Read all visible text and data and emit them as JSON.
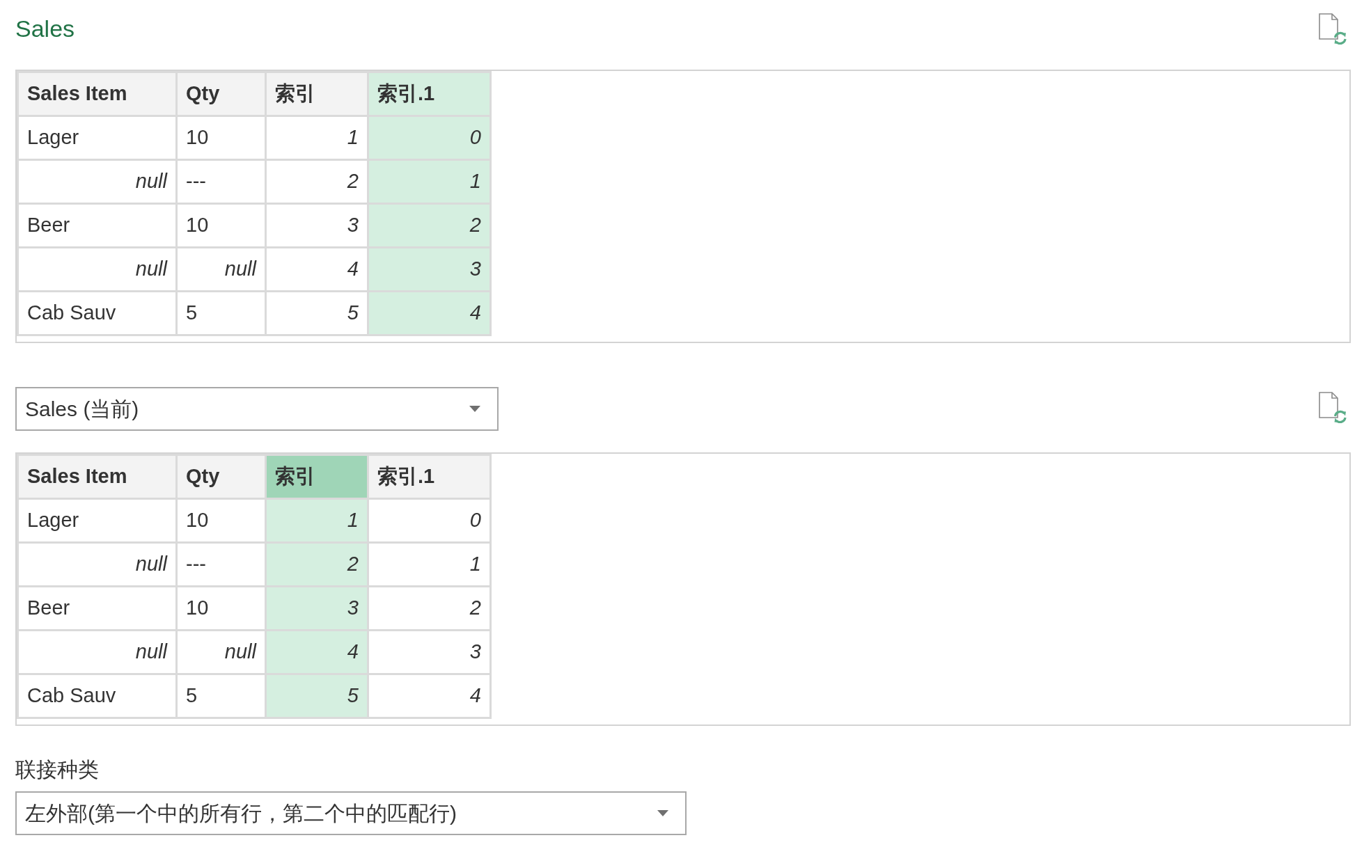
{
  "query_title": "Sales",
  "first_table": {
    "columns": [
      {
        "label": "Sales Item",
        "selected": false,
        "focused": false
      },
      {
        "label": "Qty",
        "selected": false,
        "focused": false
      },
      {
        "label": "索引",
        "selected": false,
        "focused": false
      },
      {
        "label": "索引.1",
        "selected": true,
        "focused": false
      }
    ],
    "rows": [
      {
        "cells": [
          {
            "value": "Lager",
            "kind": "text"
          },
          {
            "value": "10",
            "kind": "text"
          },
          {
            "value": "1",
            "kind": "number"
          },
          {
            "value": "0",
            "kind": "number"
          }
        ]
      },
      {
        "cells": [
          {
            "value": "null",
            "kind": "null"
          },
          {
            "value": "---",
            "kind": "text"
          },
          {
            "value": "2",
            "kind": "number"
          },
          {
            "value": "1",
            "kind": "number"
          }
        ]
      },
      {
        "cells": [
          {
            "value": "Beer",
            "kind": "text"
          },
          {
            "value": "10",
            "kind": "text"
          },
          {
            "value": "3",
            "kind": "number"
          },
          {
            "value": "2",
            "kind": "number"
          }
        ]
      },
      {
        "cells": [
          {
            "value": "null",
            "kind": "null"
          },
          {
            "value": "null",
            "kind": "null"
          },
          {
            "value": "4",
            "kind": "number"
          },
          {
            "value": "3",
            "kind": "number"
          }
        ]
      },
      {
        "cells": [
          {
            "value": "Cab Sauv",
            "kind": "text"
          },
          {
            "value": "5",
            "kind": "text"
          },
          {
            "value": "5",
            "kind": "number"
          },
          {
            "value": "4",
            "kind": "number"
          }
        ]
      }
    ]
  },
  "second_query_dropdown": {
    "value": "Sales (当前)"
  },
  "second_table": {
    "columns": [
      {
        "label": "Sales Item",
        "selected": false,
        "focused": false
      },
      {
        "label": "Qty",
        "selected": false,
        "focused": false
      },
      {
        "label": "索引",
        "selected": true,
        "focused": true
      },
      {
        "label": "索引.1",
        "selected": false,
        "focused": false
      }
    ],
    "rows": [
      {
        "cells": [
          {
            "value": "Lager",
            "kind": "text"
          },
          {
            "value": "10",
            "kind": "text"
          },
          {
            "value": "1",
            "kind": "number"
          },
          {
            "value": "0",
            "kind": "number"
          }
        ]
      },
      {
        "cells": [
          {
            "value": "null",
            "kind": "null"
          },
          {
            "value": "---",
            "kind": "text"
          },
          {
            "value": "2",
            "kind": "number"
          },
          {
            "value": "1",
            "kind": "number"
          }
        ]
      },
      {
        "cells": [
          {
            "value": "Beer",
            "kind": "text"
          },
          {
            "value": "10",
            "kind": "text"
          },
          {
            "value": "3",
            "kind": "number"
          },
          {
            "value": "2",
            "kind": "number"
          }
        ]
      },
      {
        "cells": [
          {
            "value": "null",
            "kind": "null"
          },
          {
            "value": "null",
            "kind": "null"
          },
          {
            "value": "4",
            "kind": "number"
          },
          {
            "value": "3",
            "kind": "number"
          }
        ]
      },
      {
        "cells": [
          {
            "value": "Cab Sauv",
            "kind": "text"
          },
          {
            "value": "5",
            "kind": "text"
          },
          {
            "value": "5",
            "kind": "number"
          },
          {
            "value": "4",
            "kind": "number"
          }
        ]
      }
    ]
  },
  "join_kind": {
    "label": "联接种类",
    "value": "左外部(第一个中的所有行，第二个中的匹配行)"
  }
}
